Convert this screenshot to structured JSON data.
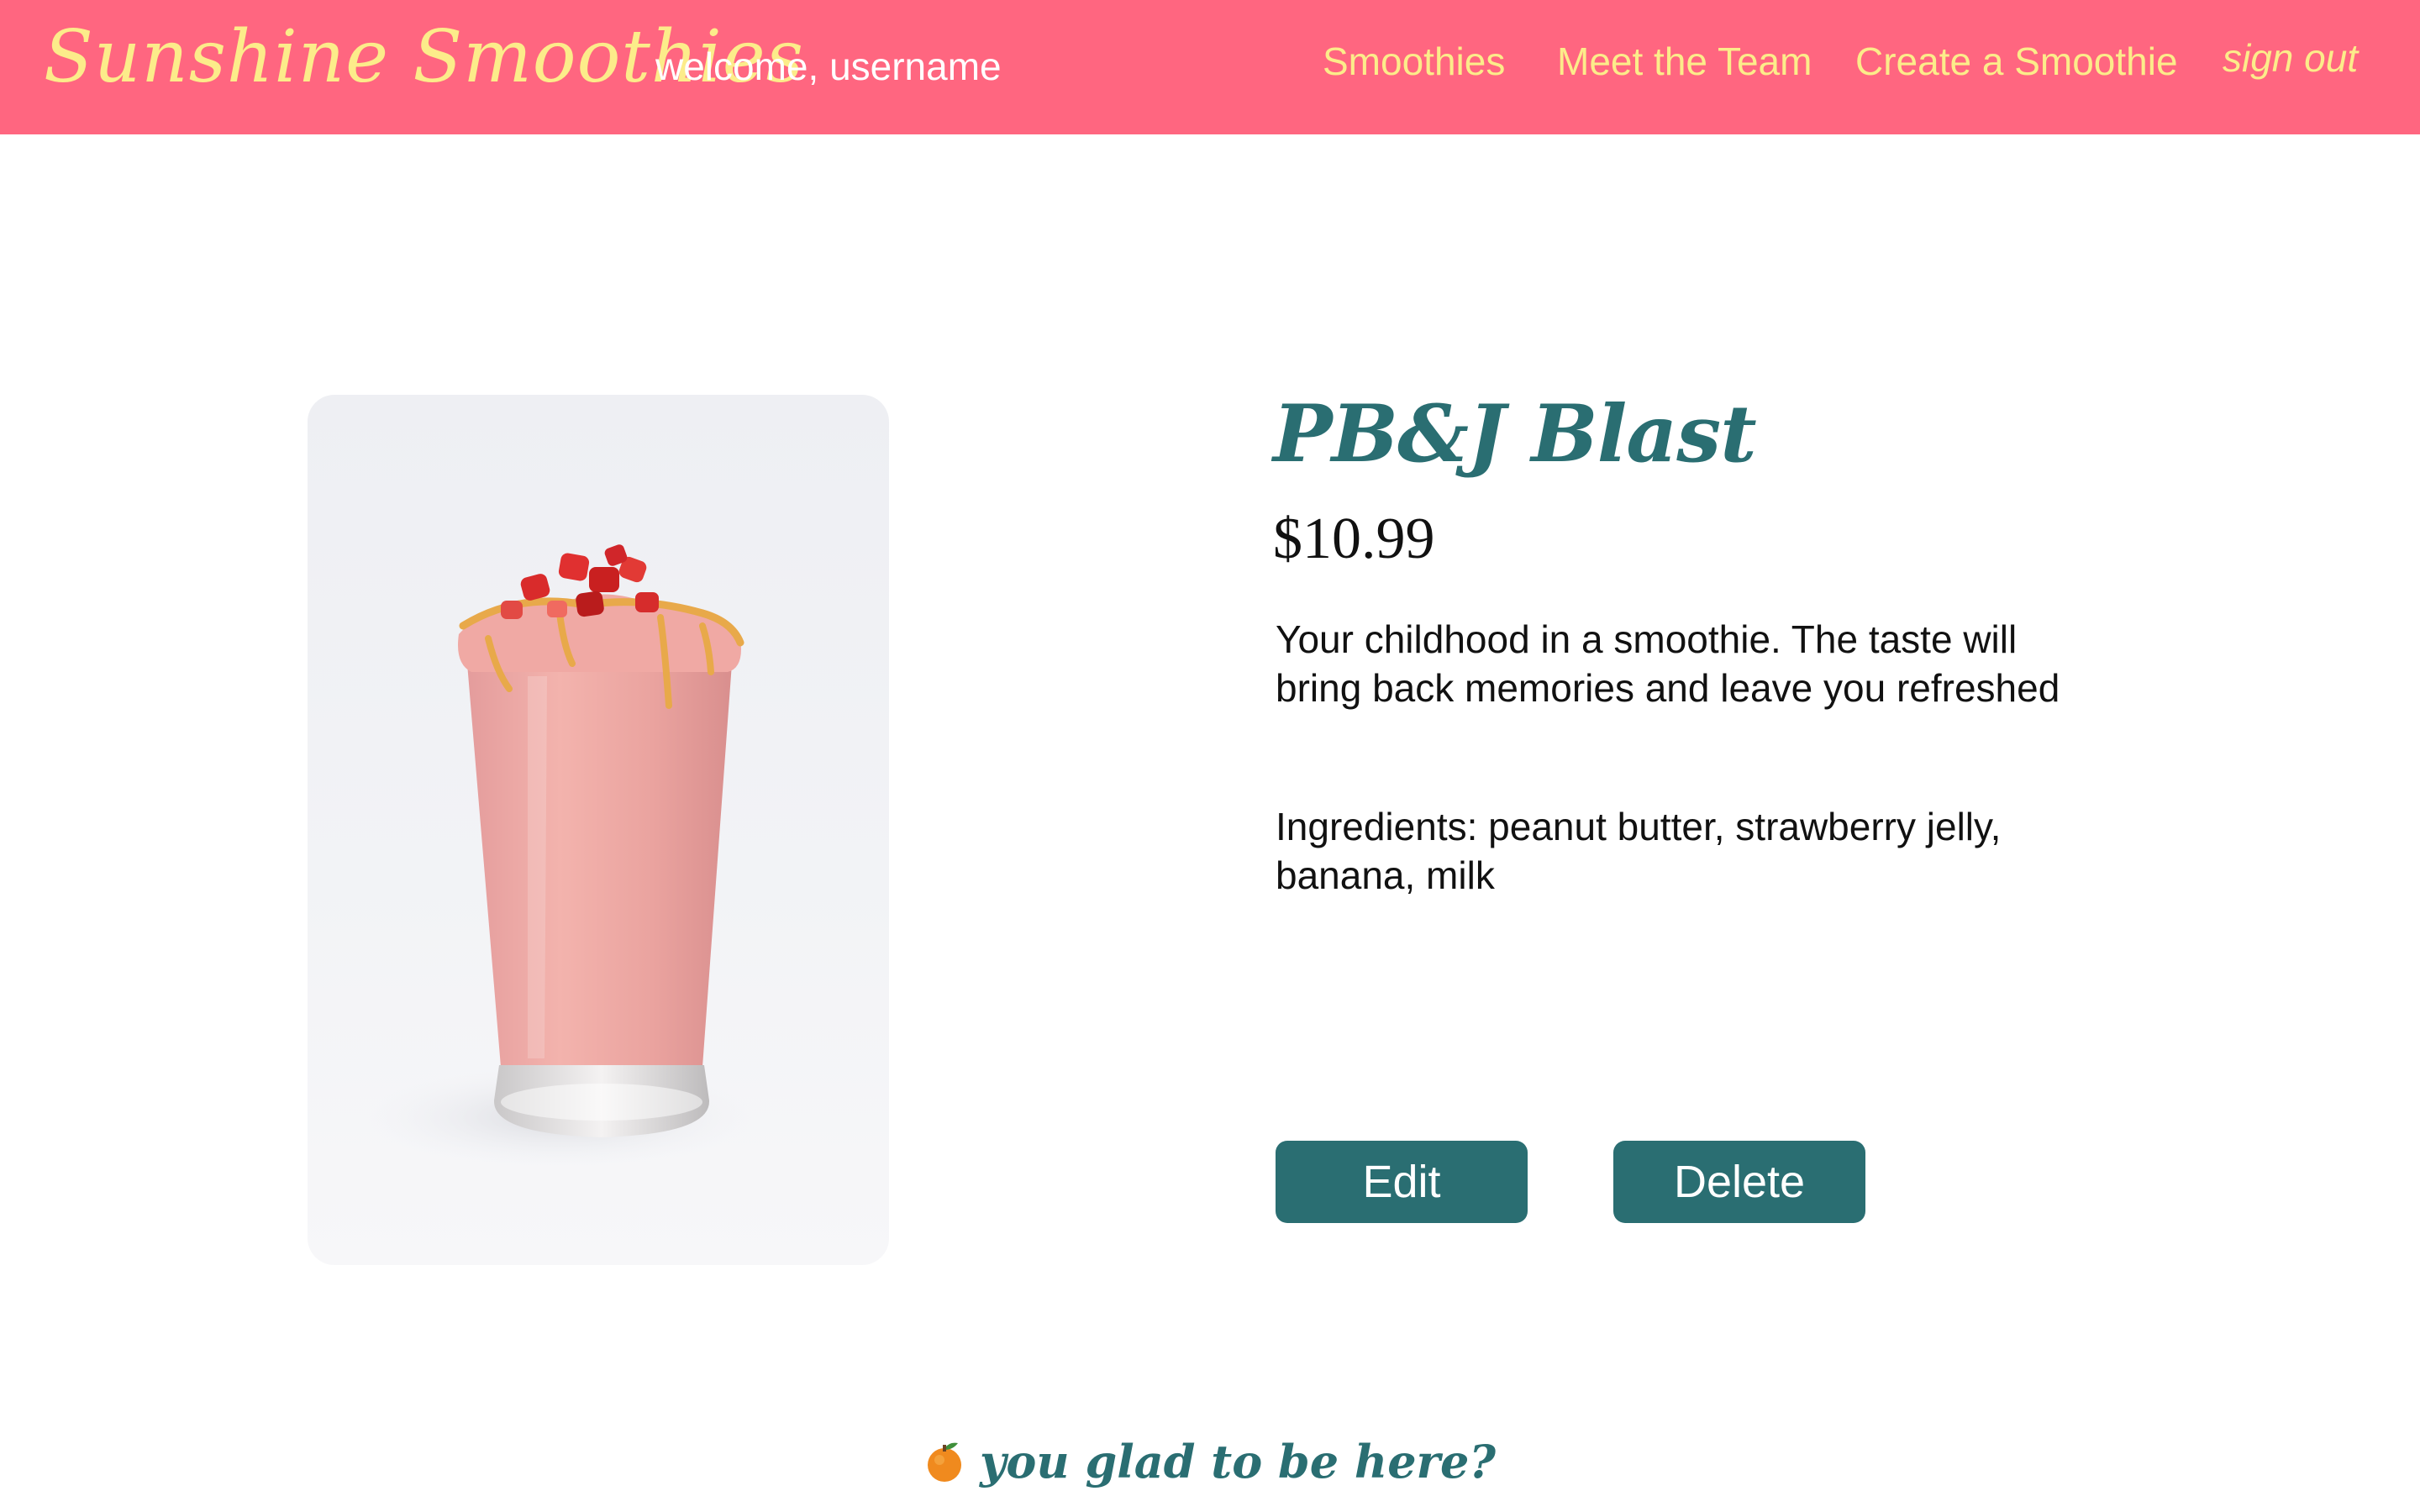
{
  "header": {
    "brand": "Sunshine Smoothies",
    "welcome": "welcome, username",
    "nav": {
      "smoothies": "Smoothies",
      "team": "Meet the Team",
      "create": "Create a Smoothie",
      "signout": "sign out"
    }
  },
  "product": {
    "title": "PB&J Blast",
    "price": "$10.99",
    "description": "Your childhood in a smoothie. The taste will bring back memories and leave you refreshed",
    "ingredients": "Ingredients: peanut butter, strawberry jelly, banana, milk",
    "image_icon": "smoothie-glass-photo"
  },
  "actions": {
    "edit": "Edit",
    "delete": "Delete"
  },
  "footer": {
    "icon": "orange-icon",
    "text": "you glad to be here?"
  },
  "colors": {
    "header_bg": "#ff6680",
    "header_text": "#fcec8a",
    "accent": "#2a6e72"
  }
}
